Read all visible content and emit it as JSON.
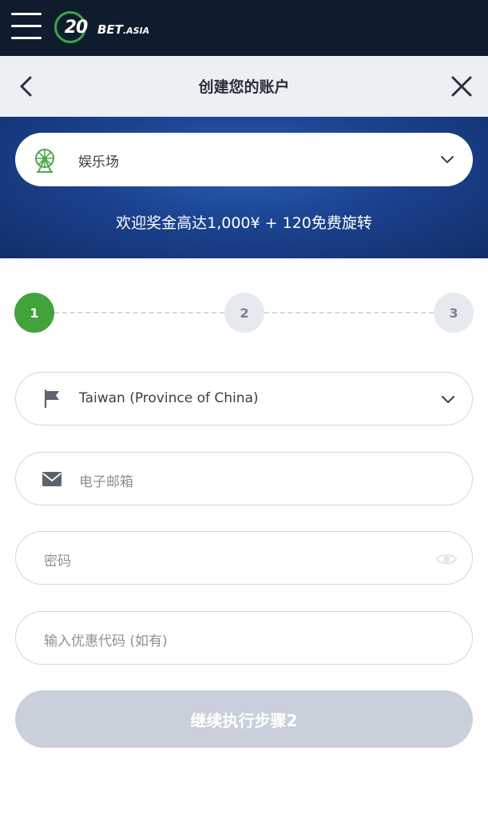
{
  "header": {
    "brand_num": "20",
    "brand_name": "BET",
    "brand_suffix": ".ASIA",
    "title": "创建您的账户"
  },
  "promo": {
    "product": "娱乐场",
    "bonus_text": "欢迎奖金高达1,000¥ + 120免费旋转"
  },
  "steps": [
    "1",
    "2",
    "3"
  ],
  "active_step": 1,
  "form": {
    "country_value": "Taiwan (Province of China)",
    "email_placeholder": "电子邮箱",
    "password_placeholder": "密码",
    "promo_code_placeholder": "输入优惠代码 (如有)",
    "continue_label": "继续执行步骤2"
  },
  "colors": {
    "topbar": "#0f1c2e",
    "accent_green": "#41a33a",
    "promo_blue": "#1b4390",
    "disabled_button": "#c9d0dc"
  },
  "icons": [
    "menu-icon",
    "back-arrow-icon",
    "close-icon",
    "ferris-wheel-icon",
    "chevron-down-icon",
    "flag-icon",
    "envelope-icon",
    "eye-icon"
  ]
}
